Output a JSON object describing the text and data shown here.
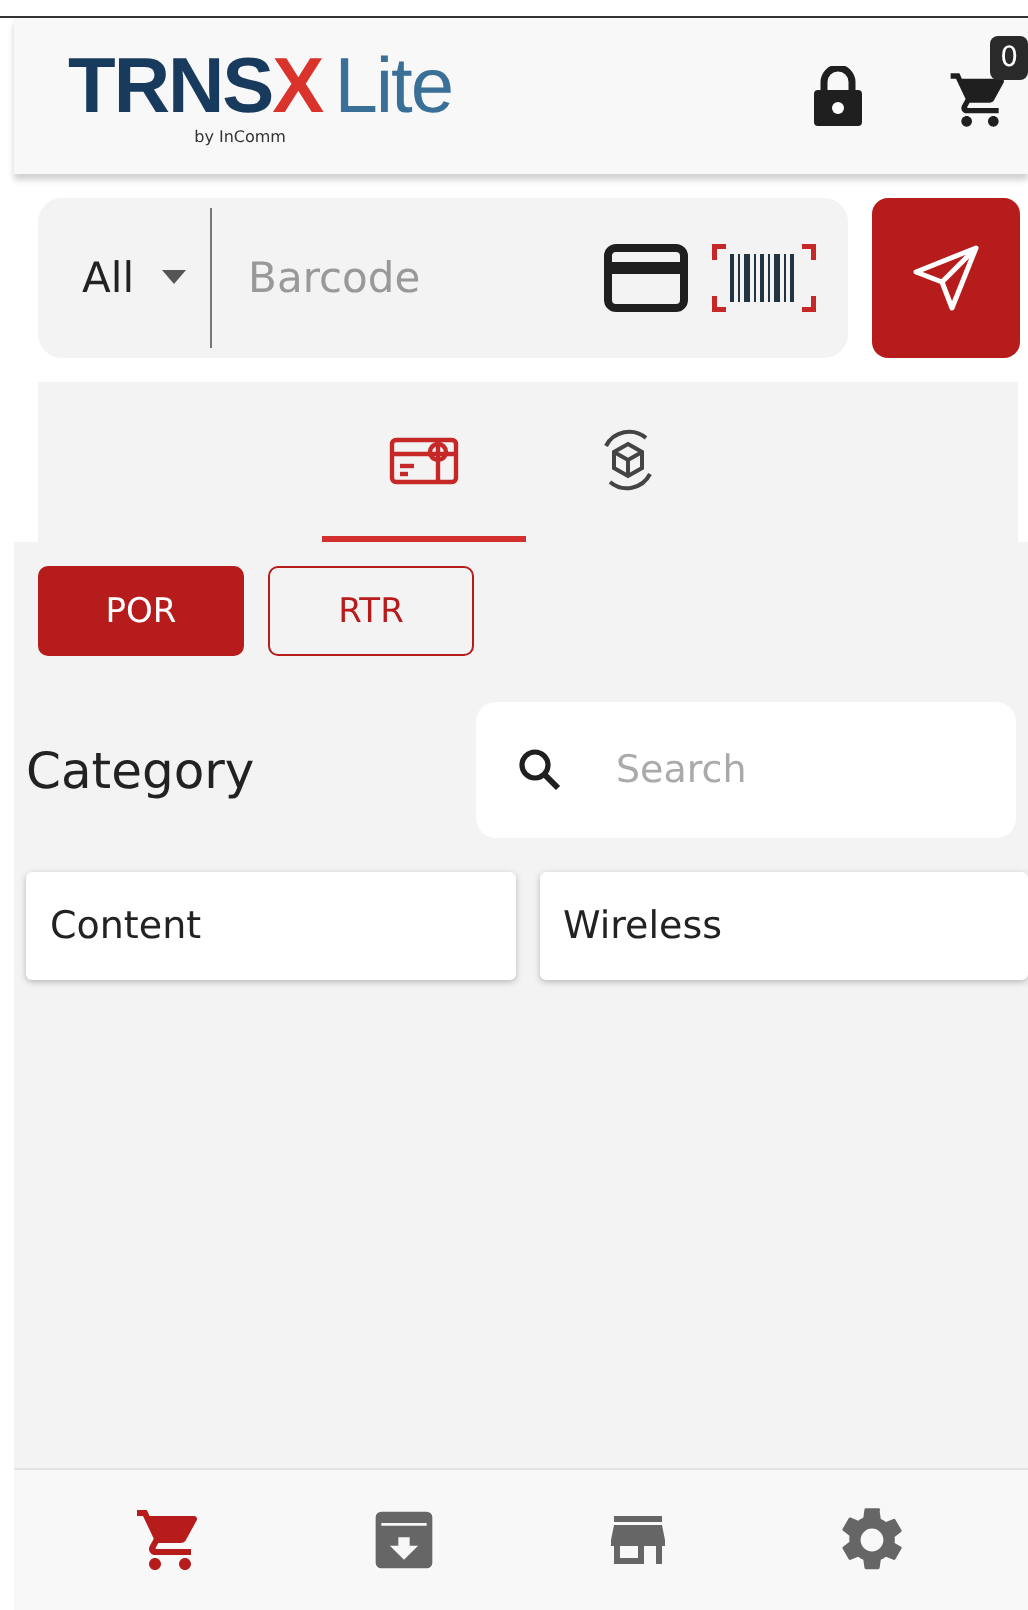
{
  "header": {
    "logo": {
      "main": "TRNS",
      "accent": "X",
      "suffix": "Lite",
      "tagline": "by InComm"
    },
    "cart_count": "0"
  },
  "scan_bar": {
    "filter": "All",
    "placeholder": "Barcode"
  },
  "tabs": [
    {
      "kind": "card",
      "selected": true
    },
    {
      "kind": "exchange",
      "selected": false
    }
  ],
  "segments": [
    {
      "label": "POR",
      "selected": true
    },
    {
      "label": "RTR",
      "selected": false
    }
  ],
  "category": {
    "title": "Category",
    "search_placeholder": "Search"
  },
  "categories": [
    "Content",
    "Wireless"
  ],
  "bottom_nav": [
    {
      "kind": "cart",
      "selected": true
    },
    {
      "kind": "archive",
      "selected": false
    },
    {
      "kind": "store",
      "selected": false
    },
    {
      "kind": "settings",
      "selected": false
    }
  ]
}
